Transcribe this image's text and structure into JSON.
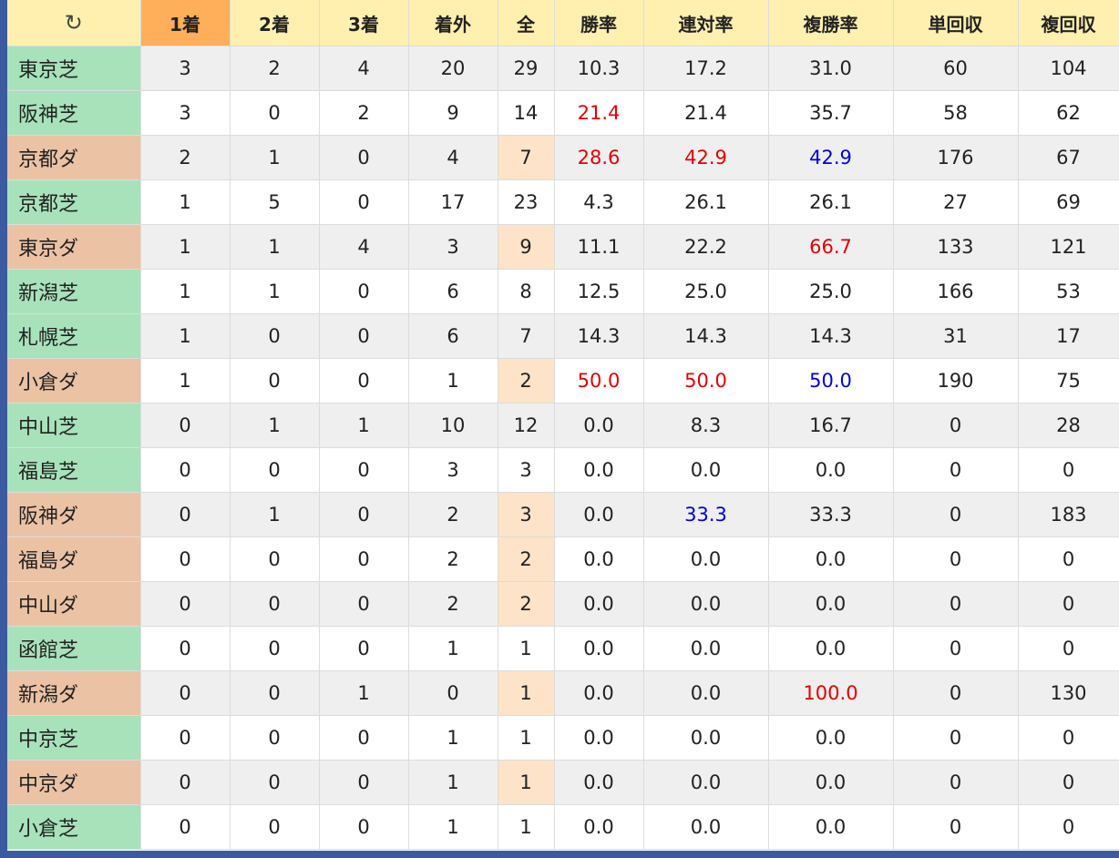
{
  "header": {
    "reload_icon": "↻",
    "columns": [
      "1着",
      "2着",
      "3着",
      "着外",
      "全",
      "勝率",
      "連対率",
      "複勝率",
      "単回収",
      "複回収"
    ]
  },
  "colors": {
    "turf_bg": "#a8e2bb",
    "dirt_bg": "#ebc2a4",
    "sorted_header_bg": "#ffae5a",
    "header_bg": "#fff0b0",
    "low_count_bg": "#fde3c8",
    "highlight_red": "#e60000",
    "highlight_blue": "#0000e0"
  },
  "rows": [
    {
      "venue": "東京芝",
      "surface": "turf",
      "c1": "3",
      "c2": "2",
      "c3": "4",
      "out": "20",
      "total": "29",
      "win": "10.3",
      "quin": "17.2",
      "place": "31.0",
      "win_ret": "60",
      "place_ret": "104",
      "low": false,
      "hl": {}
    },
    {
      "venue": "阪神芝",
      "surface": "turf",
      "c1": "3",
      "c2": "0",
      "c3": "2",
      "out": "9",
      "total": "14",
      "win": "21.4",
      "quin": "21.4",
      "place": "35.7",
      "win_ret": "58",
      "place_ret": "62",
      "low": false,
      "hl": {
        "win": "red"
      }
    },
    {
      "venue": "京都ダ",
      "surface": "dirt",
      "c1": "2",
      "c2": "1",
      "c3": "0",
      "out": "4",
      "total": "7",
      "win": "28.6",
      "quin": "42.9",
      "place": "42.9",
      "win_ret": "176",
      "place_ret": "67",
      "low": true,
      "hl": {
        "win": "red",
        "quin": "red",
        "place": "blue"
      }
    },
    {
      "venue": "京都芝",
      "surface": "turf",
      "c1": "1",
      "c2": "5",
      "c3": "0",
      "out": "17",
      "total": "23",
      "win": "4.3",
      "quin": "26.1",
      "place": "26.1",
      "win_ret": "27",
      "place_ret": "69",
      "low": false,
      "hl": {}
    },
    {
      "venue": "東京ダ",
      "surface": "dirt",
      "c1": "1",
      "c2": "1",
      "c3": "4",
      "out": "3",
      "total": "9",
      "win": "11.1",
      "quin": "22.2",
      "place": "66.7",
      "win_ret": "133",
      "place_ret": "121",
      "low": true,
      "hl": {
        "place": "red"
      }
    },
    {
      "venue": "新潟芝",
      "surface": "turf",
      "c1": "1",
      "c2": "1",
      "c3": "0",
      "out": "6",
      "total": "8",
      "win": "12.5",
      "quin": "25.0",
      "place": "25.0",
      "win_ret": "166",
      "place_ret": "53",
      "low": false,
      "hl": {}
    },
    {
      "venue": "札幌芝",
      "surface": "turf",
      "c1": "1",
      "c2": "0",
      "c3": "0",
      "out": "6",
      "total": "7",
      "win": "14.3",
      "quin": "14.3",
      "place": "14.3",
      "win_ret": "31",
      "place_ret": "17",
      "low": false,
      "hl": {}
    },
    {
      "venue": "小倉ダ",
      "surface": "dirt",
      "c1": "1",
      "c2": "0",
      "c3": "0",
      "out": "1",
      "total": "2",
      "win": "50.0",
      "quin": "50.0",
      "place": "50.0",
      "win_ret": "190",
      "place_ret": "75",
      "low": true,
      "hl": {
        "win": "red",
        "quin": "red",
        "place": "blue"
      }
    },
    {
      "venue": "中山芝",
      "surface": "turf",
      "c1": "0",
      "c2": "1",
      "c3": "1",
      "out": "10",
      "total": "12",
      "win": "0.0",
      "quin": "8.3",
      "place": "16.7",
      "win_ret": "0",
      "place_ret": "28",
      "low": false,
      "hl": {}
    },
    {
      "venue": "福島芝",
      "surface": "turf",
      "c1": "0",
      "c2": "0",
      "c3": "0",
      "out": "3",
      "total": "3",
      "win": "0.0",
      "quin": "0.0",
      "place": "0.0",
      "win_ret": "0",
      "place_ret": "0",
      "low": false,
      "hl": {}
    },
    {
      "venue": "阪神ダ",
      "surface": "dirt",
      "c1": "0",
      "c2": "1",
      "c3": "0",
      "out": "2",
      "total": "3",
      "win": "0.0",
      "quin": "33.3",
      "place": "33.3",
      "win_ret": "0",
      "place_ret": "183",
      "low": true,
      "hl": {
        "quin": "blue"
      }
    },
    {
      "venue": "福島ダ",
      "surface": "dirt",
      "c1": "0",
      "c2": "0",
      "c3": "0",
      "out": "2",
      "total": "2",
      "win": "0.0",
      "quin": "0.0",
      "place": "0.0",
      "win_ret": "0",
      "place_ret": "0",
      "low": true,
      "hl": {}
    },
    {
      "venue": "中山ダ",
      "surface": "dirt",
      "c1": "0",
      "c2": "0",
      "c3": "0",
      "out": "2",
      "total": "2",
      "win": "0.0",
      "quin": "0.0",
      "place": "0.0",
      "win_ret": "0",
      "place_ret": "0",
      "low": true,
      "hl": {}
    },
    {
      "venue": "函館芝",
      "surface": "turf",
      "c1": "0",
      "c2": "0",
      "c3": "0",
      "out": "1",
      "total": "1",
      "win": "0.0",
      "quin": "0.0",
      "place": "0.0",
      "win_ret": "0",
      "place_ret": "0",
      "low": false,
      "hl": {}
    },
    {
      "venue": "新潟ダ",
      "surface": "dirt",
      "c1": "0",
      "c2": "0",
      "c3": "1",
      "out": "0",
      "total": "1",
      "win": "0.0",
      "quin": "0.0",
      "place": "100.0",
      "win_ret": "0",
      "place_ret": "130",
      "low": true,
      "hl": {
        "place": "red"
      }
    },
    {
      "venue": "中京芝",
      "surface": "turf",
      "c1": "0",
      "c2": "0",
      "c3": "0",
      "out": "1",
      "total": "1",
      "win": "0.0",
      "quin": "0.0",
      "place": "0.0",
      "win_ret": "0",
      "place_ret": "0",
      "low": false,
      "hl": {}
    },
    {
      "venue": "中京ダ",
      "surface": "dirt",
      "c1": "0",
      "c2": "0",
      "c3": "0",
      "out": "1",
      "total": "1",
      "win": "0.0",
      "quin": "0.0",
      "place": "0.0",
      "win_ret": "0",
      "place_ret": "0",
      "low": true,
      "hl": {}
    },
    {
      "venue": "小倉芝",
      "surface": "turf",
      "c1": "0",
      "c2": "0",
      "c3": "0",
      "out": "1",
      "total": "1",
      "win": "0.0",
      "quin": "0.0",
      "place": "0.0",
      "win_ret": "0",
      "place_ret": "0",
      "low": false,
      "hl": {}
    }
  ]
}
